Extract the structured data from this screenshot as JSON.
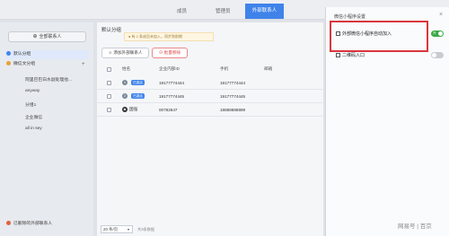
{
  "colors": {
    "accent": "#3f83ea",
    "toggle_on": "#3aa845",
    "highlight": "#d9363e",
    "danger": "#d94444"
  },
  "tabs": [
    {
      "label": "成员"
    },
    {
      "label": "管理员"
    },
    {
      "label": "外部联系人"
    }
  ],
  "sidebar": {
    "all_contacts_label": "全部联系人",
    "items": [
      {
        "label": "默认分组",
        "icon": "folder-icon"
      },
      {
        "label": "微信文分组",
        "icon": "folder-icon"
      },
      {
        "label": "阿里巴巴白水副处理他..."
      },
      {
        "label": "anyway"
      },
      {
        "label": "分组1"
      },
      {
        "label": "企业微信"
      },
      {
        "label": "all in sey"
      }
    ],
    "deleted_label": "已删除的外部联系人"
  },
  "main": {
    "group_title": "默认分组",
    "notice": "有 2 条成员未加入，同步到前期",
    "add_button": "添加外部联系人",
    "delete_button": "批量移除",
    "columns": [
      "姓名",
      "企业内部ID",
      "手机",
      "邮箱"
    ],
    "rows": [
      {
        "num": "1",
        "badge": "已激活",
        "id": "19177774444",
        "phone": "19177774444"
      },
      {
        "num": "2",
        "badge": "已激活",
        "id": "19177774445",
        "phone": "19177774445"
      },
      {
        "name": "国强",
        "id": "00782647",
        "phone": "18888888889"
      }
    ],
    "page_size": "20 条/页",
    "total": "共3条数据"
  },
  "panel": {
    "title": "微信小程序设置",
    "options": [
      {
        "label": "外部微信小程序自动加入",
        "toggle_state": "on",
        "toggle_text": "开"
      },
      {
        "label": "二维码入口",
        "toggle_state": "off"
      }
    ]
  },
  "watermark": "网易号 | 百京"
}
